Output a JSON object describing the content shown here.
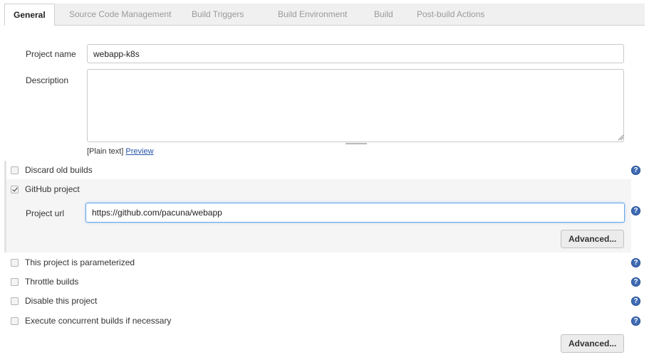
{
  "tabs": [
    {
      "label": "General"
    },
    {
      "label": "Source Code Management"
    },
    {
      "label": "Build Triggers"
    },
    {
      "label": "Build Environment"
    },
    {
      "label": "Build"
    },
    {
      "label": "Post-build Actions"
    }
  ],
  "general": {
    "project_name_label": "Project name",
    "project_name_value": "webapp-k8s",
    "description_label": "Description",
    "description_value": "",
    "plain_text_label": "[Plain text]",
    "preview_link": "Preview"
  },
  "options": {
    "discard_old_builds": {
      "label": "Discard old builds",
      "checked": false
    },
    "github_project": {
      "label": "GitHub project",
      "checked": true
    },
    "parameterized": {
      "label": "This project is parameterized",
      "checked": false
    },
    "throttle": {
      "label": "Throttle builds",
      "checked": false
    },
    "disable": {
      "label": "Disable this project",
      "checked": false
    },
    "concurrent": {
      "label": "Execute concurrent builds if necessary",
      "checked": false
    }
  },
  "github": {
    "project_url_label": "Project url",
    "project_url_value": "https://github.com/pacuna/webapp",
    "advanced_label": "Advanced..."
  },
  "footer": {
    "advanced_label": "Advanced..."
  },
  "help_icon_glyph": "?",
  "colors": {
    "help_icon": "#3e6bb3",
    "link": "#2554a8",
    "focus_border": "#6aa6e8"
  }
}
